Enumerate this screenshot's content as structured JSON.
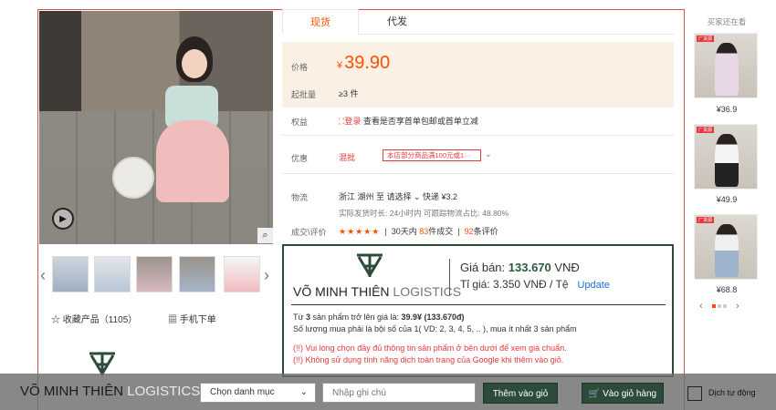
{
  "product": {
    "video_icon": "play-icon",
    "zoom_icon": "magnifier-icon",
    "collect_label": "收藏产品（1105）",
    "mobile_label": "手机下单"
  },
  "tabs": [
    "现货",
    "代发"
  ],
  "price": {
    "label": "价格",
    "currency": "¥",
    "value": "39.90",
    "moq_label": "起批量",
    "moq_value": "≥3 件"
  },
  "rights": {
    "label": "权益",
    "login": "登录",
    "text": "查看是否享首单包邮或首单立减"
  },
  "promo": {
    "label": "优惠",
    "type": "混批",
    "tag": "本店部分商品满100元或1···"
  },
  "logistics": {
    "label": "物流",
    "line": "浙江 湖州  至  请选择 ⌄   快递 ¥3.2",
    "line2": "实际发货时长: 24小时内   可跟踪物流占比: 48.80%"
  },
  "reviews": {
    "label": "成交\\评价",
    "stars": "★★★★★",
    "text_pre": "30天内",
    "sold": "83",
    "text_mid": "件成交",
    "count": "92",
    "text_post": "条评价"
  },
  "vmt": {
    "brand_strong": "VÕ MINH THIÊN",
    "brand_light": " LOGISTICS",
    "price_label": "Giá bán: ",
    "price_value": "133.670",
    "price_unit": " VNĐ",
    "rate_label": "Tỉ giá: 3.350 VNĐ / Tệ",
    "update": "Update",
    "line1_pre": "Từ ",
    "line1_qty": "3",
    "line1_mid": " sản phẩm trở lên giá là: ",
    "line1_price": "39.9¥ (133.670đ)",
    "line2": "Số lượng mua phải là bội số của 1( VD: 2, 3, 4, 5, .. ), mua ít nhất 3 sản phẩm",
    "warn1": "(!!) Vui lòng chọn đầy đủ thông tin sản phẩm ở bên dưới để xem giá chuẩn.",
    "warn2": "(!!) Không sử dụng tính năng dịch toàn trang của Google khi thêm vào giỏ."
  },
  "sidebar": {
    "title": "买家还在看",
    "items": [
      {
        "tag": "厂货源",
        "price": "¥36.9"
      },
      {
        "tag": "厂货源",
        "price": "¥49.9"
      },
      {
        "tag": "厂货源",
        "price": "¥68.8"
      }
    ]
  },
  "bottom_bar": {
    "brand_strong": "VÕ MINH THIÊN",
    "brand_light": " LOGISTICS",
    "category_select": "Chọn danh mục",
    "note_placeholder": "Nhập ghi chú",
    "add_cart_button": "Thêm vào giỏ",
    "go_cart_button": "🛒 Vào giỏ hàng",
    "auto_translate": "Dịch tự động"
  },
  "colors": {
    "accent_orange": "#ff5000",
    "brand_green": "#2d4b3a",
    "price_bg": "#fbf0e4"
  }
}
